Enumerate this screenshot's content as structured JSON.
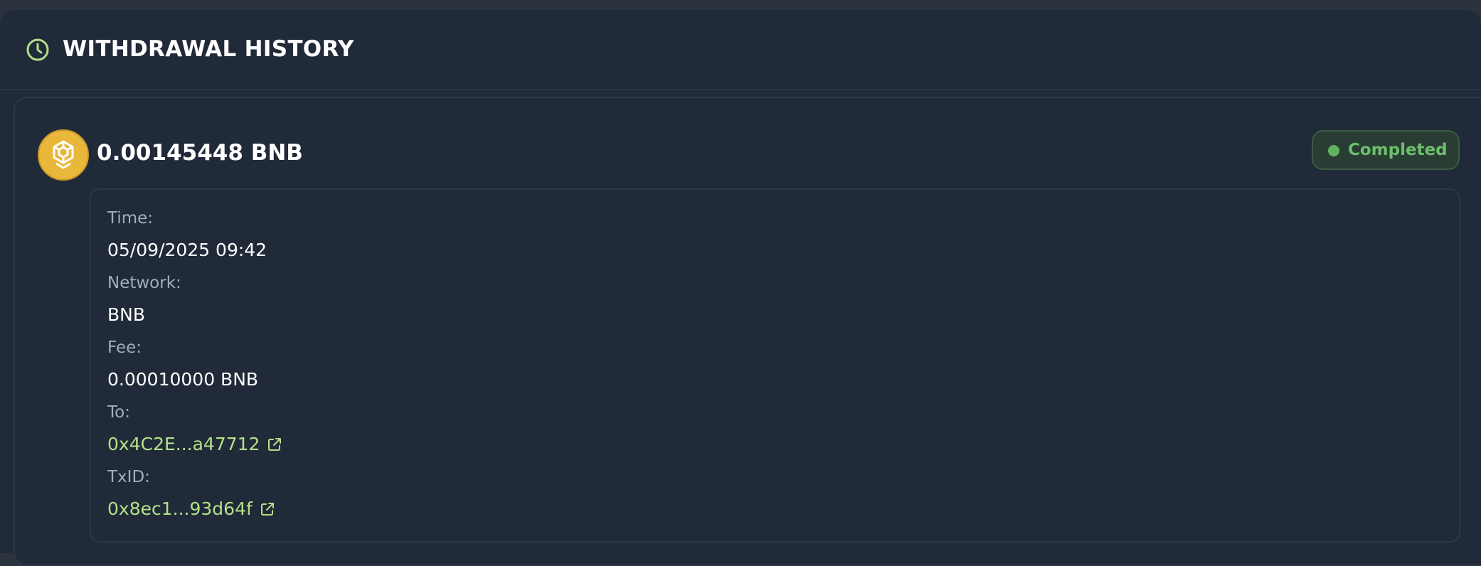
{
  "header": {
    "title": "WITHDRAWAL HISTORY",
    "icon": "clock-icon"
  },
  "colors": {
    "accent_green": "#b4e08a",
    "status_green": "#6cbf6c",
    "bnb_gold": "#f0b90b"
  },
  "withdrawal": {
    "amount": "0.00145448 BNB",
    "coin_icon": "bnb-icon",
    "status": "Completed",
    "details": {
      "time_label": "Time:",
      "time_value": "05/09/2025 09:42",
      "network_label": "Network:",
      "network_value": "BNB",
      "fee_label": "Fee:",
      "fee_value": "0.00010000 BNB",
      "to_label": "To:",
      "to_value": "0x4C2E...a47712",
      "txid_label": "TxID:",
      "txid_value": "0x8ec1...93d64f"
    }
  }
}
